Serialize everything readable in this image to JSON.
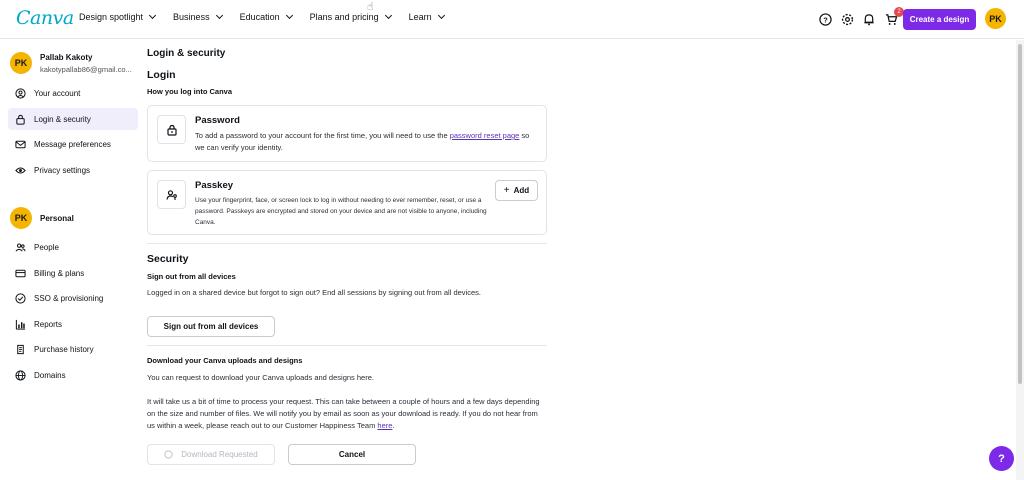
{
  "header": {
    "logo": "Canva",
    "nav": [
      {
        "label": "Design spotlight"
      },
      {
        "label": "Business"
      },
      {
        "label": "Education"
      },
      {
        "label": "Plans and pricing"
      },
      {
        "label": "Learn"
      }
    ],
    "cart_badge": "2",
    "create_button": "Create a design",
    "avatar_initials": "PK"
  },
  "sidebar": {
    "user_name": "Pallab Kakoty",
    "user_email": "kakotypallab86@gmail.co...",
    "avatar_initials": "PK",
    "account_items": [
      {
        "label": "Your account",
        "icon": "person-icon"
      },
      {
        "label": "Login & security",
        "icon": "lock-icon",
        "active": true
      },
      {
        "label": "Message preferences",
        "icon": "mail-icon"
      },
      {
        "label": "Privacy settings",
        "icon": "privacy-icon"
      }
    ],
    "team_name": "Personal",
    "team_initials": "PK",
    "team_items": [
      {
        "label": "People",
        "icon": "people-icon"
      },
      {
        "label": "Billing & plans",
        "icon": "card-icon"
      },
      {
        "label": "SSO & provisioning",
        "icon": "sso-icon"
      },
      {
        "label": "Reports",
        "icon": "reports-icon"
      },
      {
        "label": "Purchase history",
        "icon": "history-icon"
      },
      {
        "label": "Domains",
        "icon": "globe-icon"
      }
    ]
  },
  "main": {
    "page_title": "Login & security",
    "login": {
      "heading": "Login",
      "subheading": "How you log into Canva",
      "password": {
        "title": "Password",
        "desc_before": "To add a password to your account for the first time, you will need to use the ",
        "link": "password reset page",
        "desc_after": " so we can verify your identity."
      },
      "passkey": {
        "title": "Passkey",
        "desc": "Use your fingerprint, face, or screen lock to log in without needing to ever remember, reset, or use a password. Passkeys are encrypted and stored on your device and are not visible to anyone, including Canva.",
        "add_button": "Add"
      }
    },
    "security": {
      "heading": "Security",
      "signout_heading": "Sign out from all devices",
      "signout_desc": "Logged in on a shared device but forgot to sign out? End all sessions by signing out from all devices.",
      "signout_button": "Sign out from all devices",
      "download_heading": "Download your Canva uploads and designs",
      "download_desc": "You can request to download your Canva uploads and designs here.",
      "download_info": "It will take us a bit of time to process your request. This can take between a couple of hours and a few days depending on the size and number of files. We will notify you by email as soon as your download is ready. If you do not hear from us within a week, please reach out to our Customer Happiness Team ",
      "download_link": "here",
      "download_info_end": ".",
      "download_requested_button": "Download Requested",
      "cancel_button": "Cancel"
    }
  },
  "help_button": "?"
}
